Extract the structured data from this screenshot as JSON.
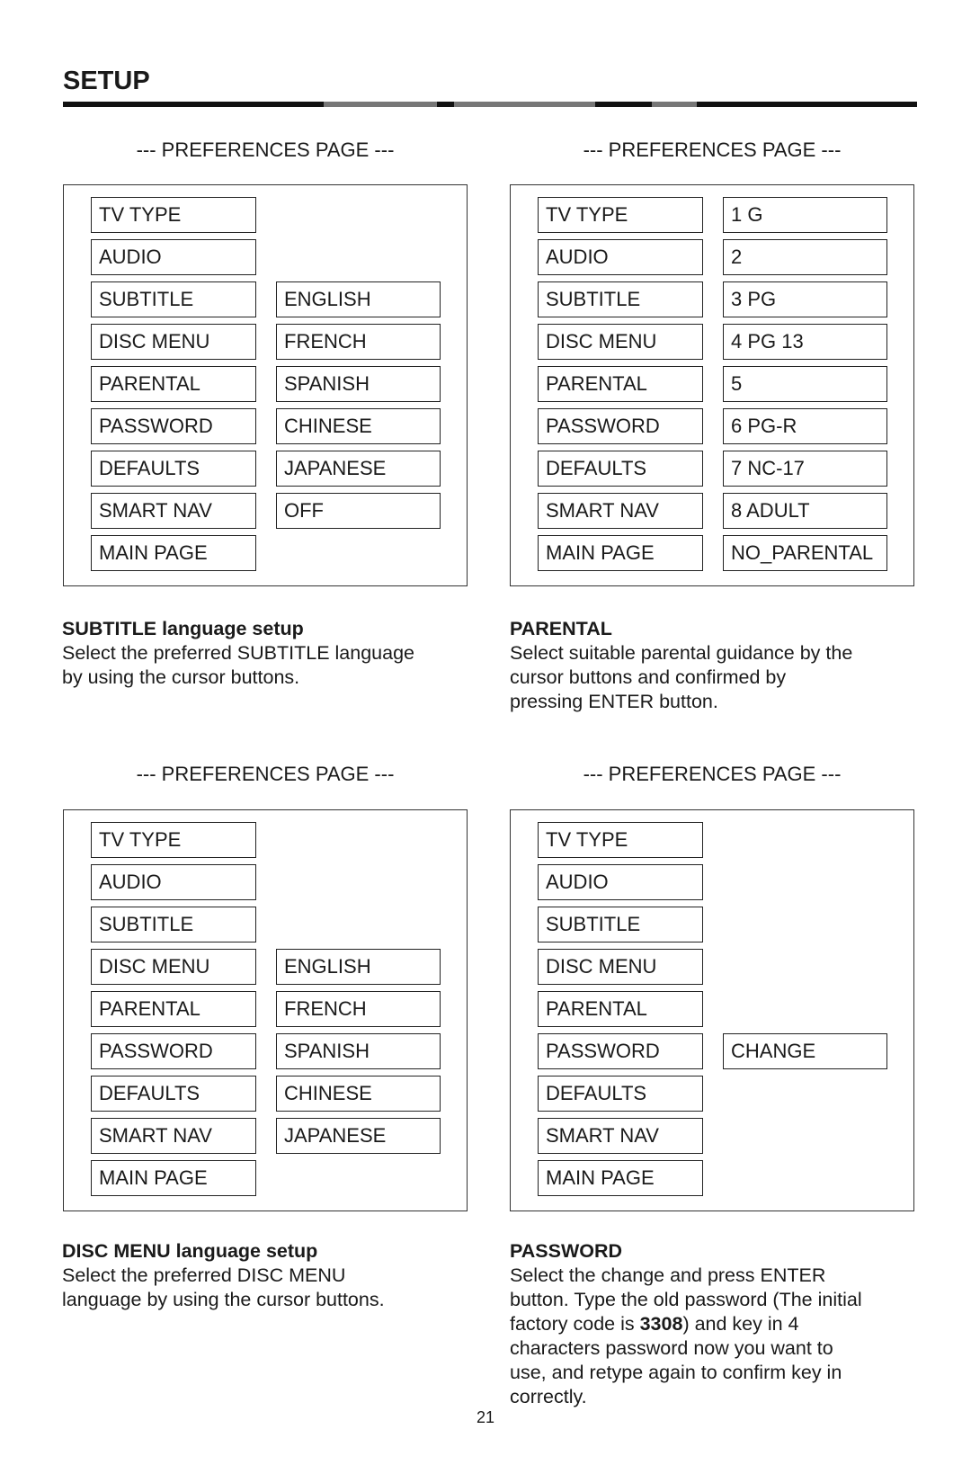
{
  "header": {
    "title": "SETUP"
  },
  "page_number": "21",
  "menu_items": [
    "TV TYPE",
    "AUDIO",
    "SUBTITLE",
    "DISC MENU",
    "PARENTAL",
    "PASSWORD",
    "DEFAULTS",
    "SMART NAV",
    "MAIN PAGE"
  ],
  "panels": [
    {
      "heading": "--- PREFERENCES PAGE ---",
      "menu": [
        "TV TYPE",
        "AUDIO",
        "SUBTITLE",
        "DISC MENU",
        "PARENTAL",
        "PASSWORD",
        "DEFAULTS",
        "SMART NAV",
        "MAIN PAGE"
      ],
      "options_start_row": 2,
      "options": [
        "ENGLISH",
        "FRENCH",
        "SPANISH",
        "CHINESE",
        "JAPANESE",
        "OFF"
      ],
      "caption": {
        "title": "SUBTITLE language setup",
        "lines": [
          "Select the preferred SUBTITLE language",
          "by using the cursor buttons."
        ]
      }
    },
    {
      "heading": "--- PREFERENCES PAGE ---",
      "menu": [
        "TV TYPE",
        "AUDIO",
        "SUBTITLE",
        "DISC MENU",
        "PARENTAL",
        "PASSWORD",
        "DEFAULTS",
        "SMART NAV",
        "MAIN PAGE"
      ],
      "options_start_row": 0,
      "options": [
        "1 G",
        "2",
        "3 PG",
        "4 PG 13",
        "5",
        "6 PG-R",
        "7 NC-17",
        "8 ADULT",
        "NO_PARENTAL"
      ],
      "caption": {
        "title": "PARENTAL",
        "lines": [
          "Select suitable parental guidance by the",
          "cursor buttons and confirmed by",
          "pressing ENTER button."
        ]
      }
    },
    {
      "heading": "--- PREFERENCES PAGE ---",
      "menu": [
        "TV TYPE",
        "AUDIO",
        "SUBTITLE",
        "DISC MENU",
        "PARENTAL",
        "PASSWORD",
        "DEFAULTS",
        "SMART NAV",
        "MAIN PAGE"
      ],
      "options_start_row": 3,
      "options": [
        "ENGLISH",
        "FRENCH",
        "SPANISH",
        "CHINESE",
        "JAPANESE"
      ],
      "caption": {
        "title": "DISC MENU language setup",
        "lines": [
          "Select the preferred DISC MENU",
          "language by using the cursor buttons."
        ]
      }
    },
    {
      "heading": "--- PREFERENCES PAGE ---",
      "menu": [
        "TV TYPE",
        "AUDIO",
        "SUBTITLE",
        "DISC MENU",
        "PARENTAL",
        "PASSWORD",
        "DEFAULTS",
        "SMART NAV",
        "MAIN PAGE"
      ],
      "options_start_row": 5,
      "options": [
        "CHANGE"
      ],
      "caption": {
        "title": "PASSWORD",
        "lines": [
          "Select the change and press ENTER",
          "button.  Type the old password (The initial",
          "factory code is ",
          "3308",
          ") and key in 4",
          "characters password now you want to",
          "use, and retype again to confirm key in",
          "correctly."
        ]
      }
    }
  ]
}
